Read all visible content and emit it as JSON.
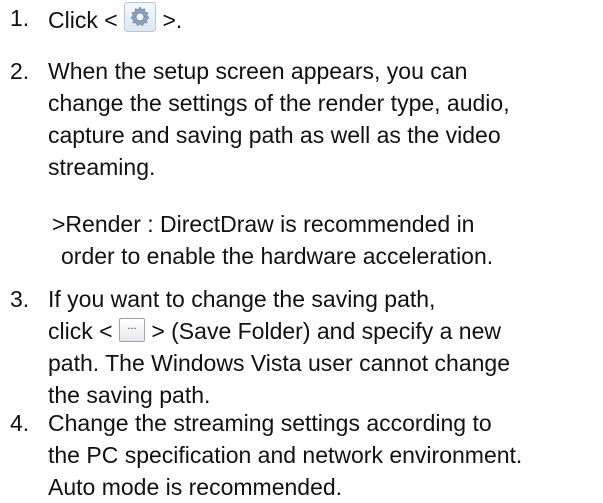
{
  "steps": [
    {
      "number": "1.",
      "pre": "Click <",
      "icon": "gear-settings-icon",
      "post": ">."
    },
    {
      "number": "2.",
      "lines": [
        "When the setup screen appears, you can",
        "change the settings of the render type, audio,",
        "capture and saving path as well as the video",
        "streaming."
      ],
      "note_lines": [
        ">Render : DirectDraw is recommended in",
        "order to enable the hardware acceleration."
      ]
    },
    {
      "number": "3.",
      "line1": "If you want to change the saving path,",
      "pre": "click <",
      "icon": "ellipsis-button-icon",
      "icon_text": "...",
      "post": "> (Save Folder) and specify a new",
      "rest_lines": [
        "path. The Windows Vista user cannot change",
        "the saving path."
      ]
    },
    {
      "number": "4.",
      "lines": [
        "Change the streaming settings according to",
        "the PC specification and network environment.",
        "Auto mode is recommended."
      ]
    }
  ]
}
